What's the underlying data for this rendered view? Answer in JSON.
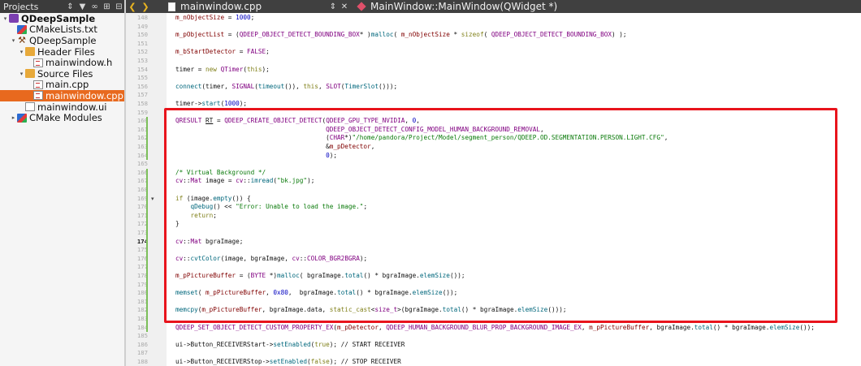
{
  "sidebar": {
    "title": "Projects",
    "toolbar_icons": [
      "dropdown-icon",
      "filter-icon",
      "link-icon",
      "split-icon",
      "close-icon"
    ],
    "items": [
      {
        "label": "QDeepSample",
        "depth": 0,
        "arrow": "▾",
        "icon": "cmake-project-icon",
        "bold": true,
        "selected": false
      },
      {
        "label": "CMakeLists.txt",
        "depth": 1,
        "arrow": "",
        "icon": "cmake-file-icon",
        "bold": false,
        "selected": false
      },
      {
        "label": "QDeepSample",
        "depth": 1,
        "arrow": "▾",
        "icon": "hammer-icon",
        "bold": false,
        "selected": false
      },
      {
        "label": "Header Files",
        "depth": 2,
        "arrow": "▾",
        "icon": "folder-icon",
        "bold": false,
        "selected": false
      },
      {
        "label": "mainwindow.h",
        "depth": 3,
        "arrow": "",
        "icon": "header-file-icon",
        "bold": false,
        "selected": false
      },
      {
        "label": "Source Files",
        "depth": 2,
        "arrow": "▾",
        "icon": "folder-icon",
        "bold": false,
        "selected": false
      },
      {
        "label": "main.cpp",
        "depth": 3,
        "arrow": "",
        "icon": "cpp-file-icon",
        "bold": false,
        "selected": false
      },
      {
        "label": "mainwindow.cpp",
        "depth": 3,
        "arrow": "",
        "icon": "cpp-file-icon",
        "bold": false,
        "selected": true
      },
      {
        "label": "mainwindow.ui",
        "depth": 2,
        "arrow": "",
        "icon": "ui-file-icon",
        "bold": false,
        "selected": false
      },
      {
        "label": "CMake Modules",
        "depth": 1,
        "arrow": "▸",
        "icon": "cmake-file-icon",
        "bold": false,
        "selected": false
      }
    ]
  },
  "tabs": {
    "file": "mainwindow.cpp",
    "symbol": "MainWindow::MainWindow(QWidget *)"
  },
  "editor": {
    "current_line": "174",
    "line_numbers": [
      "148",
      "149",
      "150",
      "151",
      "152",
      "153",
      "154",
      "155",
      "156",
      "157",
      "158",
      "159",
      "160",
      "161",
      "162",
      "163",
      "164",
      "165",
      "166",
      "167",
      "168",
      "169",
      "170",
      "171",
      "172",
      "173",
      "174",
      "175",
      "176",
      "177",
      "178",
      "179",
      "180",
      "181",
      "182",
      "183",
      "184",
      "185",
      "186",
      "187",
      "188",
      "189",
      "190"
    ],
    "lines": [
      {
        "ln": "148",
        "text": "m_nObjectSize = 1000;"
      },
      {
        "ln": "150",
        "text": "m_pObjectList = (QDEEP_OBJECT_DETECT_BOUNDING_BOX* )malloc( m_nObjectSize * sizeof( QDEEP_OBJECT_DETECT_BOUNDING_BOX) );"
      },
      {
        "ln": "152",
        "text": "m_bStartDetector = FALSE;"
      },
      {
        "ln": "154",
        "text": "timer = new QTimer(this);"
      },
      {
        "ln": "156",
        "text": "connect(timer, SIGNAL(timeout()), this, SLOT(TimerSlot()));"
      },
      {
        "ln": "158",
        "text": "timer->start(1000);"
      },
      {
        "ln": "160",
        "text": "QRESULT RT = QDEEP_CREATE_OBJECT_DETECT(QDEEP_GPU_TYPE_NVIDIA, 0,"
      },
      {
        "ln": "161",
        "text": "                                        QDEEP_OBJECT_DETECT_CONFIG_MODEL_HUMAN_BACKGROUND_REMOVAL,"
      },
      {
        "ln": "162",
        "text": "                                        (CHAR*)\"/home/pandora/Project/Model/segment_person/QDEEP.OD.SEGMENTATION.PERSON.LIGHT.CFG\","
      },
      {
        "ln": "163",
        "text": "                                        &m_pDetector,"
      },
      {
        "ln": "164",
        "text": "                                        0);"
      },
      {
        "ln": "166",
        "text": "/* Virtual Background */"
      },
      {
        "ln": "167",
        "text": "cv::Mat image = cv::imread(\"bk.jpg\");"
      },
      {
        "ln": "169",
        "text": "if (image.empty()) {"
      },
      {
        "ln": "170",
        "text": "    qDebug() << \"Error: Unable to load the image.\";"
      },
      {
        "ln": "171",
        "text": "    return;"
      },
      {
        "ln": "172",
        "text": "}"
      },
      {
        "ln": "174",
        "text": "cv::Mat bgraImage;"
      },
      {
        "ln": "176",
        "text": "cv::cvtColor(image, bgraImage, cv::COLOR_BGR2BGRA);"
      },
      {
        "ln": "178",
        "text": "m_pPictureBuffer = (BYTE *)malloc( bgraImage.total() * bgraImage.elemSize());"
      },
      {
        "ln": "180",
        "text": "memset( m_pPictureBuffer, 0x80,  bgraImage.total() * bgraImage.elemSize());"
      },
      {
        "ln": "182",
        "text": "memcpy(m_pPictureBuffer, bgraImage.data, static_cast<size_t>(bgraImage.total() * bgraImage.elemSize()));"
      },
      {
        "ln": "184",
        "text": "QDEEP_SET_OBJECT_DETECT_CUSTOM_PROPERTY_EX(m_pDetector, QDEEP_HUMAN_BACKGROUND_BLUR_PROP_BACKGROUND_IMAGE_EX, m_pPictureBuffer, bgraImage.total() * bgraImage.elemSize());"
      },
      {
        "ln": "186",
        "text": "ui->Button_RECEIVERStart->setEnabled(true); // START RECEIVER"
      },
      {
        "ln": "188",
        "text": "ui->Button_RECEIVERStop->setEnabled(false); // STOP RECEIVER"
      }
    ]
  },
  "colors": {
    "accent_selected": "#e8691e",
    "highlight_box": "#e8141c",
    "change_marker": "#7cbf5a"
  }
}
